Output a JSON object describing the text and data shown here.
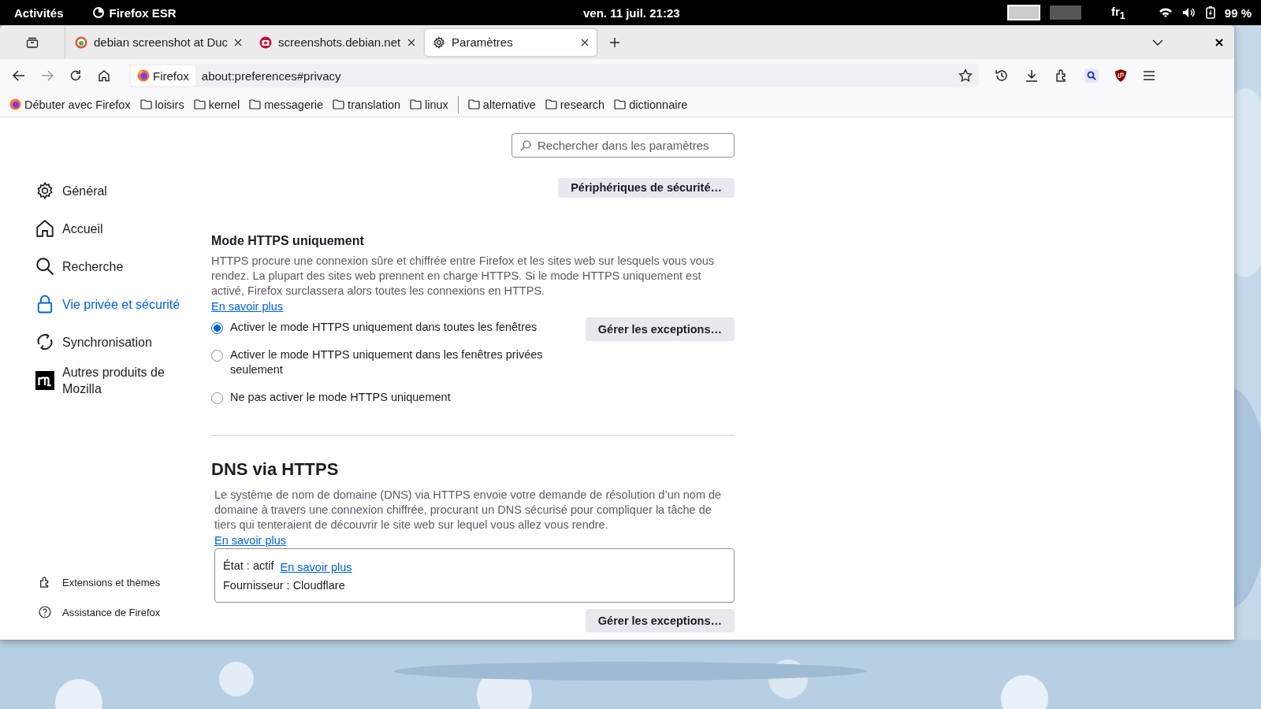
{
  "top_bar": {
    "activities": "Activités",
    "app": "Firefox ESR",
    "clock": "ven. 11 juil.  21:23",
    "workspaces": [
      {
        "selected": true
      },
      {
        "selected": false
      }
    ],
    "keyboard": "fr$_{1}$",
    "battery": "99 %"
  },
  "tabs": [
    {
      "kind": "duck",
      "title": "debian screenshot at Duc",
      "selected": false
    },
    {
      "kind": "camera",
      "title": "screenshots.debian.net",
      "selected": false
    },
    {
      "kind": "gear",
      "title": "Paramètres",
      "selected": true
    }
  ],
  "address": {
    "identity": "Firefox",
    "url": "about:preferences#privacy"
  },
  "bookmarks": [
    {
      "kind": "firefox",
      "label": "Débuter avec Firefox"
    },
    {
      "kind": "folder",
      "label": "loisirs"
    },
    {
      "kind": "folder",
      "label": "kernel"
    },
    {
      "kind": "folder",
      "label": "messagerie"
    },
    {
      "kind": "folder",
      "label": "translation"
    },
    {
      "kind": "folder",
      "label": "linux"
    },
    {
      "kind": "separator"
    },
    {
      "kind": "folder",
      "label": "alternative"
    },
    {
      "kind": "folder",
      "label": "research"
    },
    {
      "kind": "folder",
      "label": "dictionnaire"
    }
  ],
  "search": {
    "placeholder": "Rechercher dans les paramètres"
  },
  "sidebar": {
    "items": [
      {
        "kind": "gear",
        "label": "Général",
        "selected": false
      },
      {
        "kind": "home",
        "label": "Accueil",
        "selected": false
      },
      {
        "kind": "search",
        "label": "Recherche",
        "selected": false
      },
      {
        "kind": "lock",
        "label": "Vie privée et sécurité",
        "selected": true
      },
      {
        "kind": "sync",
        "label": "Synchronisation",
        "selected": false
      },
      {
        "kind": "mozilla",
        "label": "Autres produits de Mozilla",
        "selected": false
      }
    ],
    "footer": [
      {
        "kind": "puzzle",
        "label": "Extensions et thèmes"
      },
      {
        "kind": "help",
        "label": "Assistance de Firefox"
      }
    ]
  },
  "security_devices_button": "Périphériques de sécurité…",
  "https_only": {
    "title": "Mode HTTPS uniquement",
    "description": "HTTPS procure une connexion sûre et chiffrée entre Firefox et les sites web sur lesquels vous vous rendez. La plupart des sites web prennent en charge HTTPS. Si le mode HTTPS uniquement est activé, Firefox surclassera alors toutes les connexions en HTTPS.",
    "learn_more": "En savoir plus",
    "options": [
      {
        "label": "Activer le mode HTTPS uniquement dans toutes les fenêtres",
        "selected": true
      },
      {
        "label": "Activer le mode HTTPS uniquement dans les fenêtres privées seulement",
        "selected": false
      },
      {
        "label": "Ne pas activer le mode HTTPS uniquement",
        "selected": false
      }
    ],
    "button": "Gérer les exceptions…"
  },
  "dns": {
    "title": "DNS via HTTPS",
    "description": "Le système de nom de domaine (DNS) via HTTPS envoie votre demande de résolution d’un nom de domaine à travers une connexion chiffrée, procurant un DNS sécurisé pour compliquer la tâche de tiers qui tenteraient de découvrir le site web sur lequel vous allez vous rendre.",
    "learn_more": "En savoir plus",
    "status": "État : actif",
    "status_link": "En savoir plus",
    "provider": "Fournisseur : Cloudflare",
    "button": "Gérer les exceptions…"
  }
}
